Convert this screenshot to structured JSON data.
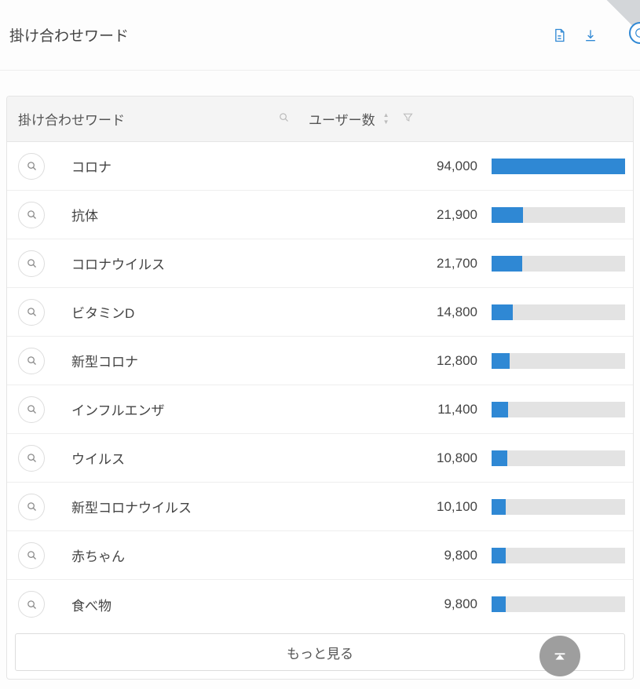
{
  "header": {
    "title": "掛け合わせワード"
  },
  "table": {
    "columns": {
      "word": "掛け合わせワード",
      "users": "ユーザー数"
    },
    "rows": [
      {
        "word": "コロナ",
        "users": 94000,
        "users_display": "94,000"
      },
      {
        "word": "抗体",
        "users": 21900,
        "users_display": "21,900"
      },
      {
        "word": "コロナウイルス",
        "users": 21700,
        "users_display": "21,700"
      },
      {
        "word": "ビタミンD",
        "users": 14800,
        "users_display": "14,800"
      },
      {
        "word": "新型コロナ",
        "users": 12800,
        "users_display": "12,800"
      },
      {
        "word": "インフルエンザ",
        "users": 11400,
        "users_display": "11,400"
      },
      {
        "word": "ウイルス",
        "users": 10800,
        "users_display": "10,800"
      },
      {
        "word": "新型コロナウイルス",
        "users": 10100,
        "users_display": "10,100"
      },
      {
        "word": "赤ちゃん",
        "users": 9800,
        "users_display": "9,800"
      },
      {
        "word": "食べ物",
        "users": 9800,
        "users_display": "9,800"
      }
    ]
  },
  "more_label": "もっと見る",
  "colors": {
    "accent": "#2f88d4",
    "bar_bg": "#e3e3e3"
  },
  "chart_data": {
    "type": "bar",
    "title": "掛け合わせワード",
    "xlabel": "ユーザー数",
    "ylabel": "",
    "categories": [
      "コロナ",
      "抗体",
      "コロナウイルス",
      "ビタミンD",
      "新型コロナ",
      "インフルエンザ",
      "ウイルス",
      "新型コロナウイルス",
      "赤ちゃん",
      "食べ物"
    ],
    "values": [
      94000,
      21900,
      21700,
      14800,
      12800,
      11400,
      10800,
      10100,
      9800,
      9800
    ],
    "ylim": [
      0,
      94000
    ]
  }
}
